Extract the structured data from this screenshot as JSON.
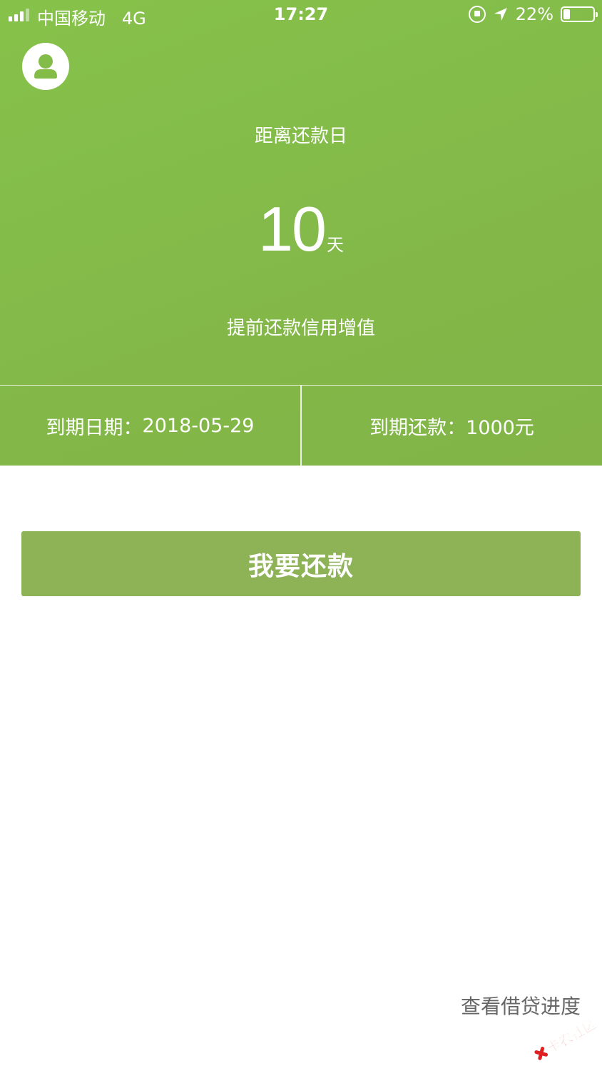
{
  "status_bar": {
    "carrier": "中国移动",
    "network": "4G",
    "time": "17:27",
    "battery_percent_label": "22%",
    "battery_level": 0.22
  },
  "countdown": {
    "label": "距离还款日",
    "days": "10",
    "unit": "天"
  },
  "slogan": "提前还款信用增值",
  "info": {
    "due_date_label": "到期日期：",
    "due_date_value": "2018-05-29",
    "due_amount_label": "到期还款：",
    "due_amount_value": "1000元"
  },
  "actions": {
    "repay_label": "我要还款",
    "progress_link": "查看借贷进度"
  },
  "watermark": "卡农社区",
  "colors": {
    "header_green": "#84bc49",
    "button_green": "#8db356",
    "link_gray": "#666666"
  }
}
